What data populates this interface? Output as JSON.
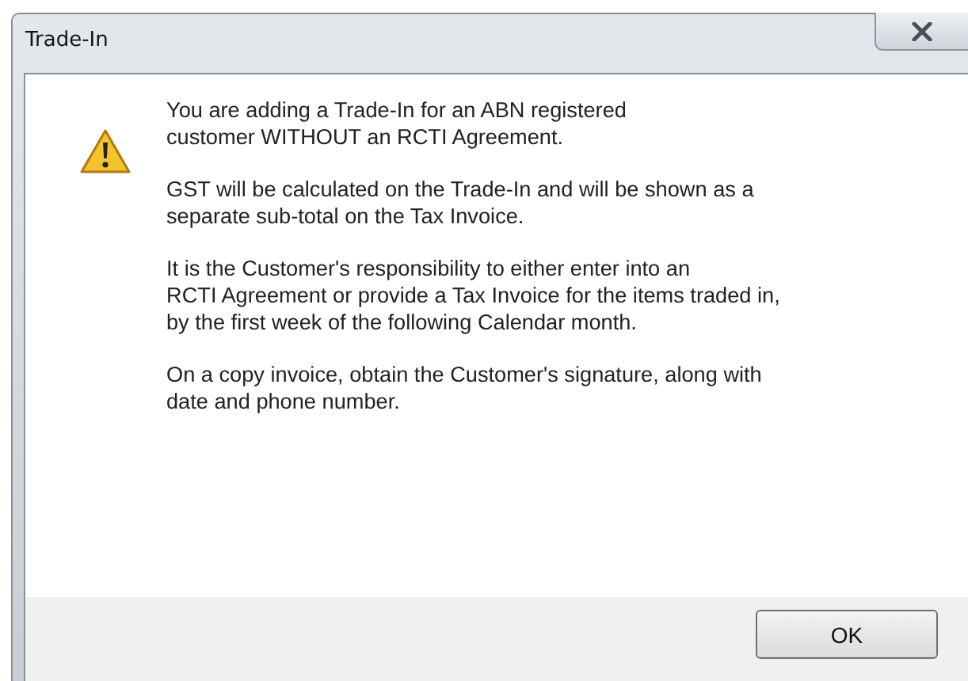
{
  "window": {
    "title": "Trade-In"
  },
  "message": {
    "paragraphs": [
      "You are adding a Trade-In for an ABN registered\ncustomer WITHOUT an RCTI Agreement.",
      "GST will be calculated on the Trade-In and will be shown as a\nseparate sub-total on the Tax Invoice.",
      "It is the Customer's responsibility to either enter into an\nRCTI Agreement or provide a Tax Invoice for the items traded in,\nby the first week of the following Calendar month.",
      "On a copy invoice, obtain the Customer's signature, along with\ndate and phone number."
    ]
  },
  "buttons": [
    "OK"
  ]
}
